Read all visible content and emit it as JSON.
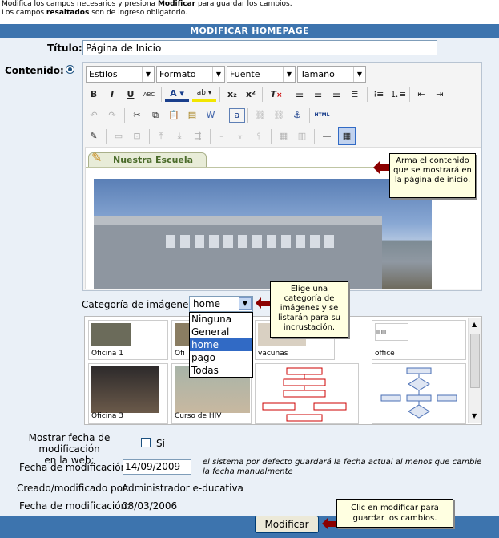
{
  "help": {
    "line1_a": "Modifica los campos necesarios y presiona ",
    "line1_b": "Modificar",
    "line1_c": " para guardar los cambios.",
    "line2_a": "Los campos ",
    "line2_b": "resaltados",
    "line2_c": " son de ingreso obligatorio."
  },
  "header": {
    "title": "MODIFICAR HOMEPAGE"
  },
  "form": {
    "titulo_label": "Título:",
    "titulo_value": "Página de Inicio",
    "contenido_label": "Contenido:"
  },
  "editor": {
    "combos": {
      "estilos": "Estilos",
      "formato": "Formato",
      "fuente": "Fuente",
      "tamano": "Tamaño"
    },
    "toolbar_row2": [
      "bold-icon",
      "italic-icon",
      "underline-icon",
      "strikethrough-icon",
      "font-color-icon",
      "highlight-icon",
      "subscript-icon",
      "superscript-icon",
      "remove-format-icon",
      "align-left-icon",
      "align-center-icon",
      "align-right-icon",
      "justify-icon",
      "bullet-list-icon",
      "numbered-list-icon",
      "outdent-icon",
      "indent-icon"
    ],
    "toolbar_labels": {
      "bold": "B",
      "italic": "I",
      "underline": "U",
      "strike": "ABC",
      "sub": "x₂",
      "sup": "x²",
      "html": "HTML"
    },
    "tab_label": "Nuestra Escuela"
  },
  "tooltips": {
    "editor": "Arma el contenido que se mostrará en la página de inicio.",
    "category": "Elige una categoría de imágenes y se listarán para su incrustación.",
    "submit": "Clic en modificar para guardar los cambios."
  },
  "category": {
    "label": "Categoría de imágenes:",
    "selected": "home",
    "options": [
      "Ninguna",
      "General",
      "home",
      "pago",
      "Todas"
    ]
  },
  "gallery": {
    "items": [
      "Oficina 1",
      "Ofi",
      "vacunas",
      "office",
      "Oficina 3",
      "Curso de HIV",
      "",
      ""
    ]
  },
  "options": {
    "mostrar_label_1": "Mostrar fecha de modificación",
    "mostrar_label_2": "en la web:",
    "si_label": "Sí",
    "fecha_label": "Fecha de modificación:",
    "fecha_value": "14/09/2009",
    "fecha_hint": "el sistema por defecto guardará la fecha actual al menos que cambie la fecha manualmente"
  },
  "info": {
    "creado_label": "Creado/modificado por:",
    "creado_value": "Administrador e-ducativa",
    "fecha_label": "Fecha de modificación:",
    "fecha_value": "08/03/2006"
  },
  "submit": {
    "label": "Modificar"
  },
  "colors": {
    "header": "#3d74ae",
    "form_bg": "#eaf0f7",
    "tooltip_bg": "#ffffe1",
    "arrow": "#8b0000",
    "selection": "#316ac5"
  }
}
